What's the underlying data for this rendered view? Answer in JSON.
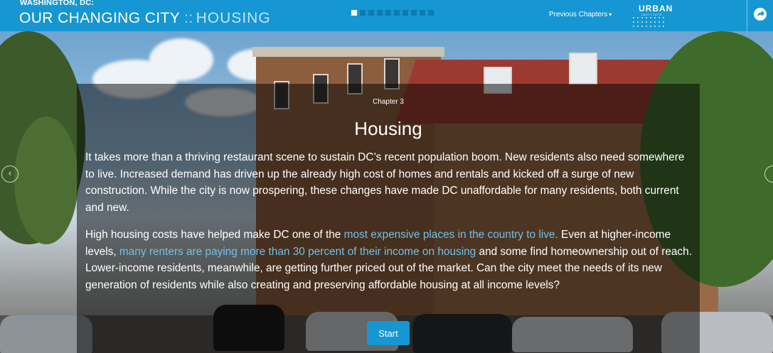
{
  "header": {
    "supertitle": "WASHINGTON, DC:",
    "title": "OUR CHANGING CITY",
    "separator": "::",
    "section": "HOUSING",
    "pagination": {
      "total": 10,
      "active_index": 0
    },
    "previous_chapters_label": "Previous Chapters",
    "previous_chapters_caret": "▾",
    "logo": {
      "word": "URBAN",
      "sub": "INSTITUTE"
    },
    "share_icon": "share-arrow-icon"
  },
  "card": {
    "chapter_label": "Chapter 3",
    "title": "Housing",
    "p1": "It takes more than a thriving restaurant scene to sustain DC’s recent population boom. New residents also need somewhere to live. Increased demand has driven up the already high cost of homes and rentals and kicked off a surge of new construction. While the city is now prospering, these changes have made DC unaffordable for many residents, both current and new.",
    "p2_a": "High housing costs have helped make DC one of the ",
    "p2_link1": "most expensive places in the country to live.",
    "p2_b": " Even at higher-income levels, ",
    "p2_link2": "many renters are paying more than 30 percent of their income on housing",
    "p2_c": " and some find homeownership out of reach. Lower-income residents, meanwhile, are getting further priced out of the market. Can the city meet the needs of its new generation of residents while also creating and preserving affordable housing at all income levels?",
    "start_label": "Start"
  },
  "nav": {
    "left_arrow": "‹",
    "left_icon": "chevron-left-icon",
    "right_icon": "chevron-right-icon"
  },
  "colors": {
    "brand_blue": "#1696d2",
    "link_blue": "#6ec1ea",
    "overlay": "rgba(0,0,0,0.50)"
  }
}
